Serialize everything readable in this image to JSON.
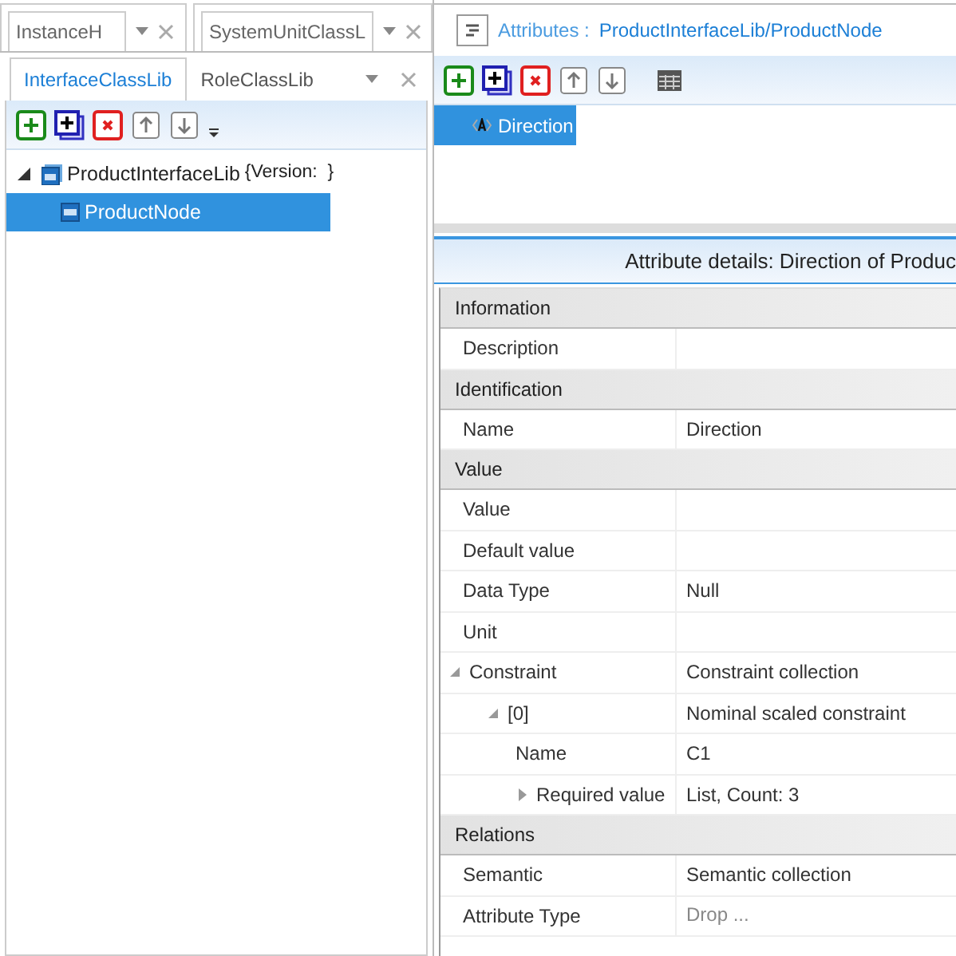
{
  "doc_tabs": [
    {
      "label": "InstanceH"
    },
    {
      "label": "SystemUnitClassL"
    }
  ],
  "panel_tabs": [
    {
      "label": "InterfaceClassLib",
      "selected": true
    },
    {
      "label": "RoleClassLib",
      "selected": false
    }
  ],
  "tree": [
    {
      "label": "ProductInterfaceLib",
      "suffix": "{Version:  }",
      "expanded": true,
      "selected": false,
      "children": [
        {
          "label": "ProductNode",
          "selected": true
        }
      ]
    }
  ],
  "attributes_header": {
    "prefix": "Attributes :",
    "path": "ProductInterfaceLib/ProductNode"
  },
  "attributes_list": [
    {
      "label": "Direction",
      "selected": true
    }
  ],
  "details_title": "Attribute details:  Direction of Produc",
  "property_grid": [
    {
      "category": "Information",
      "rows": [
        {
          "name": "Description"
        }
      ]
    },
    {
      "category": "Identification",
      "rows": [
        {
          "name": "Name",
          "value": "Direction"
        }
      ]
    },
    {
      "category": "Value",
      "rows": [
        {
          "name": "Value"
        },
        {
          "name": "Default value"
        },
        {
          "name": "Data Type",
          "value": "Null"
        },
        {
          "name": "Unit"
        },
        {
          "name": "Constraint",
          "value": "Constraint collection",
          "expanded": true,
          "children": [
            {
              "name": "[0]",
              "value": "Nominal scaled constraint",
              "expanded": true,
              "children": [
                {
                  "name": "Name",
                  "value": "C1"
                },
                {
                  "name": "Required value",
                  "value": "List, Count: 3",
                  "expanded": false
                }
              ]
            }
          ]
        }
      ]
    },
    {
      "category": "Relations",
      "rows": [
        {
          "name": "Semantic",
          "value": "Semantic collection"
        },
        {
          "name": "Attribute Type",
          "placeholder": "Drop ..."
        }
      ]
    }
  ]
}
